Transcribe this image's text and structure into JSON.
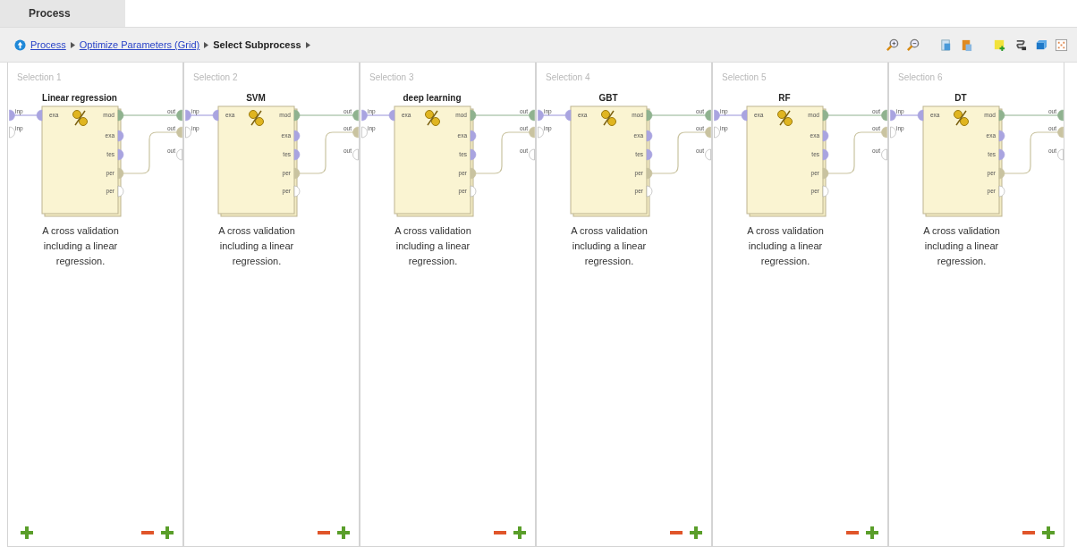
{
  "tabs": [
    {
      "label": "Process",
      "selected": true
    }
  ],
  "breadcrumb": [
    {
      "label": "Process",
      "kind": "link"
    },
    {
      "label": "Optimize Parameters (Grid)",
      "kind": "link"
    },
    {
      "label": "Select Subprocess",
      "kind": "current"
    }
  ],
  "panels": [
    {
      "title": "Selection 1",
      "left_add": true,
      "inputs": [
        {
          "label": "inp",
          "color": "#a9a4e0"
        },
        {
          "label": "inp",
          "color": "#ffffff"
        }
      ],
      "operator": {
        "name": "Linear regression",
        "inputs": [
          {
            "label": "exa",
            "color": "#a9a4e0"
          }
        ],
        "outputs": [
          {
            "label": "mod",
            "color": "#8fb28f"
          },
          {
            "label": "exa",
            "color": "#a9a4e0"
          },
          {
            "label": "tes",
            "color": "#a9a4e0"
          },
          {
            "label": "per",
            "color": "#c9c3a0"
          },
          {
            "label": "per",
            "color": "#ffffff"
          }
        ],
        "description": "A cross validation including a linear regression."
      },
      "outputs": [
        {
          "label": "out",
          "color": "#8fb28f"
        },
        {
          "label": "out",
          "color": "#c9c3a0"
        },
        {
          "label": "out",
          "color": "#ffffff"
        }
      ]
    },
    {
      "title": "Selection 2",
      "left_add": false,
      "inputs": [
        {
          "label": "inp",
          "color": "#a9a4e0"
        },
        {
          "label": "inp",
          "color": "#ffffff"
        }
      ],
      "operator": {
        "name": "SVM",
        "inputs": [
          {
            "label": "exa",
            "color": "#a9a4e0"
          }
        ],
        "outputs": [
          {
            "label": "mod",
            "color": "#8fb28f"
          },
          {
            "label": "exa",
            "color": "#a9a4e0"
          },
          {
            "label": "tes",
            "color": "#a9a4e0"
          },
          {
            "label": "per",
            "color": "#c9c3a0"
          },
          {
            "label": "per",
            "color": "#ffffff"
          }
        ],
        "description": "A cross validation including a linear regression."
      },
      "outputs": [
        {
          "label": "out",
          "color": "#8fb28f"
        },
        {
          "label": "out",
          "color": "#c9c3a0"
        },
        {
          "label": "out",
          "color": "#ffffff"
        }
      ]
    },
    {
      "title": "Selection 3",
      "left_add": false,
      "inputs": [
        {
          "label": "inp",
          "color": "#a9a4e0"
        },
        {
          "label": "inp",
          "color": "#ffffff"
        }
      ],
      "operator": {
        "name": "deep learning",
        "inputs": [
          {
            "label": "exa",
            "color": "#a9a4e0"
          }
        ],
        "outputs": [
          {
            "label": "mod",
            "color": "#8fb28f"
          },
          {
            "label": "exa",
            "color": "#a9a4e0"
          },
          {
            "label": "tes",
            "color": "#a9a4e0"
          },
          {
            "label": "per",
            "color": "#c9c3a0"
          },
          {
            "label": "per",
            "color": "#ffffff"
          }
        ],
        "description": "A cross validation including a linear regression."
      },
      "outputs": [
        {
          "label": "out",
          "color": "#8fb28f"
        },
        {
          "label": "out",
          "color": "#c9c3a0"
        },
        {
          "label": "out",
          "color": "#ffffff"
        }
      ]
    },
    {
      "title": "Selection 4",
      "left_add": false,
      "inputs": [
        {
          "label": "inp",
          "color": "#a9a4e0"
        },
        {
          "label": "inp",
          "color": "#ffffff"
        }
      ],
      "operator": {
        "name": "GBT",
        "inputs": [
          {
            "label": "exa",
            "color": "#a9a4e0"
          }
        ],
        "outputs": [
          {
            "label": "mod",
            "color": "#8fb28f"
          },
          {
            "label": "exa",
            "color": "#a9a4e0"
          },
          {
            "label": "tes",
            "color": "#a9a4e0"
          },
          {
            "label": "per",
            "color": "#c9c3a0"
          },
          {
            "label": "per",
            "color": "#ffffff"
          }
        ],
        "description": "A cross validation including a linear regression."
      },
      "outputs": [
        {
          "label": "out",
          "color": "#8fb28f"
        },
        {
          "label": "out",
          "color": "#c9c3a0"
        },
        {
          "label": "out",
          "color": "#ffffff"
        }
      ]
    },
    {
      "title": "Selection 5",
      "left_add": false,
      "inputs": [
        {
          "label": "inp",
          "color": "#a9a4e0"
        },
        {
          "label": "inp",
          "color": "#ffffff"
        }
      ],
      "operator": {
        "name": "RF",
        "inputs": [
          {
            "label": "exa",
            "color": "#a9a4e0"
          }
        ],
        "outputs": [
          {
            "label": "mod",
            "color": "#8fb28f"
          },
          {
            "label": "exa",
            "color": "#a9a4e0"
          },
          {
            "label": "tes",
            "color": "#a9a4e0"
          },
          {
            "label": "per",
            "color": "#c9c3a0"
          },
          {
            "label": "per",
            "color": "#ffffff"
          }
        ],
        "description": "A cross validation including a linear regression."
      },
      "outputs": [
        {
          "label": "out",
          "color": "#8fb28f"
        },
        {
          "label": "out",
          "color": "#c9c3a0"
        },
        {
          "label": "out",
          "color": "#ffffff"
        }
      ]
    },
    {
      "title": "Selection 6",
      "left_add": false,
      "inputs": [
        {
          "label": "inp",
          "color": "#a9a4e0"
        },
        {
          "label": "inp",
          "color": "#ffffff"
        }
      ],
      "operator": {
        "name": "DT",
        "inputs": [
          {
            "label": "exa",
            "color": "#a9a4e0"
          }
        ],
        "outputs": [
          {
            "label": "mod",
            "color": "#8fb28f"
          },
          {
            "label": "exa",
            "color": "#a9a4e0"
          },
          {
            "label": "tes",
            "color": "#a9a4e0"
          },
          {
            "label": "per",
            "color": "#c9c3a0"
          },
          {
            "label": "per",
            "color": "#ffffff"
          }
        ],
        "description": "A cross validation including a linear regression."
      },
      "outputs": [
        {
          "label": "out",
          "color": "#8fb28f"
        },
        {
          "label": "out",
          "color": "#c9c3a0"
        },
        {
          "label": "out",
          "color": "#ffffff"
        }
      ]
    }
  ]
}
